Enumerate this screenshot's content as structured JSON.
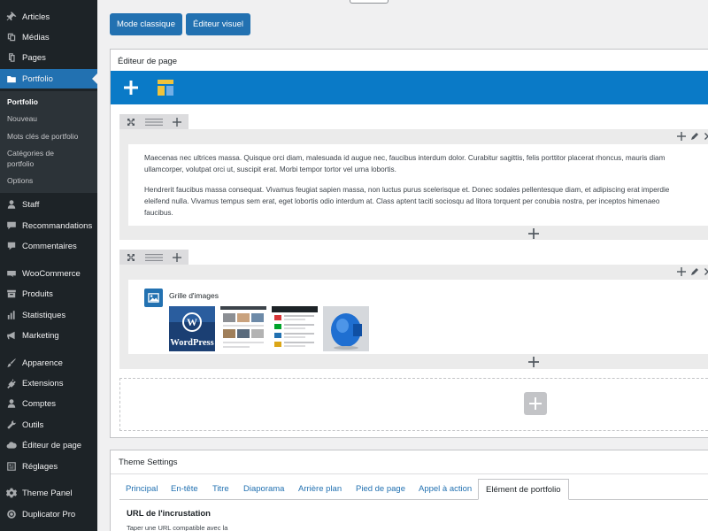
{
  "sidebar": {
    "items": [
      {
        "label": "Articles",
        "icon": "pushpin-icon"
      },
      {
        "label": "Médias",
        "icon": "media-icon"
      },
      {
        "label": "Pages",
        "icon": "pages-icon"
      },
      {
        "label": "Portfolio",
        "icon": "folder-icon"
      },
      {
        "label": "Staff",
        "icon": "user-icon"
      },
      {
        "label": "Recommandations",
        "icon": "testimonial-icon"
      },
      {
        "label": "Commentaires",
        "icon": "comment-icon"
      },
      {
        "label": "WooCommerce",
        "icon": "woo-icon"
      },
      {
        "label": "Produits",
        "icon": "archive-icon"
      },
      {
        "label": "Statistiques",
        "icon": "chart-bar-icon"
      },
      {
        "label": "Marketing",
        "icon": "megaphone-icon"
      },
      {
        "label": "Apparence",
        "icon": "paintbrush-icon"
      },
      {
        "label": "Extensions",
        "icon": "plugin-icon"
      },
      {
        "label": "Comptes",
        "icon": "users-icon"
      },
      {
        "label": "Outils",
        "icon": "wrench-icon"
      },
      {
        "label": "Éditeur de page",
        "icon": "cloud-icon"
      },
      {
        "label": "Réglages",
        "icon": "settings-icon"
      },
      {
        "label": "Theme Panel",
        "icon": "gear-icon"
      },
      {
        "label": "Duplicator Pro",
        "icon": "duplicator-icon"
      }
    ],
    "submenu": [
      "Portfolio",
      "Nouveau",
      "Mots clés de portfolio",
      "Catégories de portfolio",
      "Options"
    ]
  },
  "toolbar": {
    "classic_label": "Mode classique",
    "visual_label": "Éditeur visuel"
  },
  "builder": {
    "title": "Éditeur de page",
    "paragraph1_line1": "Maecenas nec ultrices massa. Quisque orci diam, malesuada id augue nec, faucibus interdum dolor. Curabitur sagittis, felis porttitor placerat rhoncus, mauris diam",
    "paragraph1_line2": "ullamcorper, volutpat orci ut, suscipit erat. Morbi tempor tortor vel urna lobortis.",
    "paragraph2_line1": "Hendrerit faucibus massa consequat. Vivamus feugiat sapien massa, non luctus purus scelerisque et. Donec sodales pellentesque diam, et adipiscing erat imperdie",
    "paragraph2_line2": "eleifend nulla. Vivamus tempus sem erat, eget lobortis odio interdum at. Class aptent taciti sociosqu ad litora torquent per conubia nostra, per inceptos himenaeo",
    "paragraph2_line3": "faucibus.",
    "gallery_title": "Grille d'images",
    "thumb1_text": "WordPress"
  },
  "settings": {
    "title": "Theme Settings",
    "tabs": [
      "Principal",
      "En-tête",
      "Titre",
      "Diaporama",
      "Arrière plan",
      "Pied de page",
      "Appel à action",
      "Elément de portfolio"
    ],
    "active_tab": "Elément de portfolio",
    "field_label": "URL de l'incrustation",
    "field_help": "Taper une URL compatible avec la"
  },
  "colors": {
    "sidebar_bg": "#1d2327",
    "accent": "#2271b1",
    "builder_toolbar": "#0a7ac7"
  }
}
